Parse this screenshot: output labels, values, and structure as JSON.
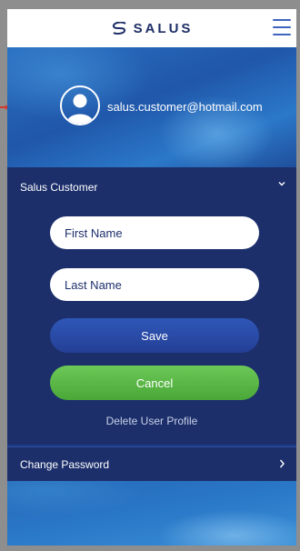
{
  "header": {
    "logo_text": "SALUS",
    "logo_icon": "salus-logo-mark",
    "menu_icon": "hamburger-menu-icon"
  },
  "profile": {
    "email": "salus.customer@hotmail.com",
    "avatar_icon": "user-avatar-icon"
  },
  "profile_section": {
    "title": "Salus Customer",
    "expand_icon": "chevron-down-icon",
    "first_name_placeholder": "First Name",
    "last_name_placeholder": "Last Name",
    "first_name_value": "",
    "last_name_value": "",
    "save_label": "Save",
    "cancel_label": "Cancel",
    "delete_label": "Delete User Profile"
  },
  "password_section": {
    "title": "Change Password",
    "icon": "chevron-right-icon"
  },
  "colors": {
    "panel": "#1c2f6b",
    "save_button": "#2f57b8",
    "cancel_button": "#5bb848",
    "accent_menu": "#3f63c0"
  }
}
